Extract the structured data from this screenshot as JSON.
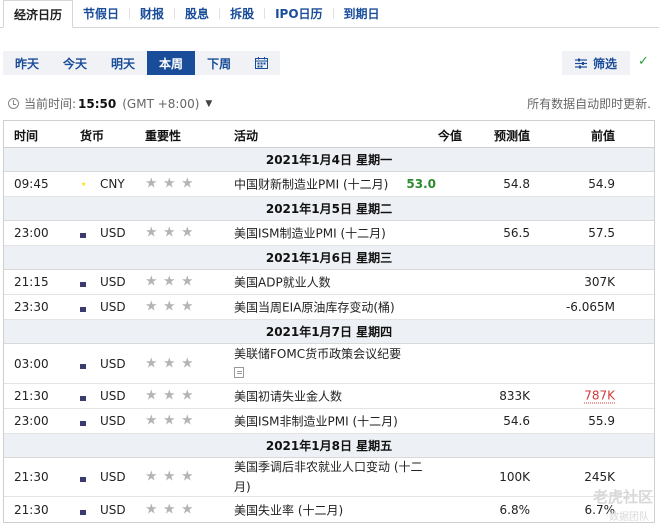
{
  "nav": {
    "tabs": [
      {
        "label": "经济日历",
        "active": true
      },
      {
        "label": "节假日"
      },
      {
        "label": "财报"
      },
      {
        "label": "股息"
      },
      {
        "label": "拆股"
      },
      {
        "label": "IPO日历"
      },
      {
        "label": "到期日"
      }
    ]
  },
  "period": {
    "buttons": [
      "昨天",
      "今天",
      "明天",
      "本周",
      "下周"
    ],
    "active": "本周",
    "calendar_icon": "calendar-icon"
  },
  "filter": {
    "label": "筛选",
    "icon": "sliders-icon"
  },
  "time": {
    "prefix": "当前时间:",
    "value": "15:50",
    "tz": "(GMT +8:00)",
    "chevron": "⌄"
  },
  "auto_update": "所有数据自动即时更新.",
  "table": {
    "headers": {
      "time": "时间",
      "currency": "货币",
      "importance": "重要性",
      "event": "活动",
      "actual": "今值",
      "forecast": "预测值",
      "previous": "前值"
    },
    "days": [
      {
        "date": "2021年1月4日  星期一",
        "rows": [
          {
            "time": "09:45",
            "flag": "cn",
            "currency": "CNY",
            "event": "中国财新制造业PMI (十二月)",
            "actual": "53.0",
            "forecast": "54.8",
            "previous": "54.9"
          }
        ]
      },
      {
        "date": "2021年1月5日  星期二",
        "rows": [
          {
            "time": "23:00",
            "flag": "us",
            "currency": "USD",
            "event": "美国ISM制造业PMI (十二月)",
            "actual": "",
            "forecast": "56.5",
            "previous": "57.5"
          }
        ]
      },
      {
        "date": "2021年1月6日  星期三",
        "rows": [
          {
            "time": "21:15",
            "flag": "us",
            "currency": "USD",
            "event": "美国ADP就业人数",
            "actual": "",
            "forecast": "",
            "previous": "307K"
          },
          {
            "time": "23:30",
            "flag": "us",
            "currency": "USD",
            "event": "美国当周EIA原油库存变动(桶)",
            "actual": "",
            "forecast": "",
            "previous": "-6.065M"
          }
        ]
      },
      {
        "date": "2021年1月7日  星期四",
        "rows": [
          {
            "time": "03:00",
            "flag": "us",
            "currency": "USD",
            "event": "美联储FOMC货币政策会议纪要",
            "actual": "",
            "forecast": "",
            "previous": ""
          },
          {
            "time": "21:30",
            "flag": "us",
            "currency": "USD",
            "event": "美国初请失业金人数",
            "actual": "",
            "forecast": "833K",
            "previous": "787K"
          },
          {
            "time": "23:00",
            "flag": "us",
            "currency": "USD",
            "event": "美国ISM非制造业PMI (十二月)",
            "actual": "",
            "forecast": "54.6",
            "previous": "55.9"
          }
        ]
      },
      {
        "date": "2021年1月8日  星期五",
        "rows": [
          {
            "time": "21:30",
            "flag": "us",
            "currency": "USD",
            "event": "美国季调后非农就业人口变动 (十二月)",
            "actual": "",
            "forecast": "100K",
            "previous": "245K"
          },
          {
            "time": "21:30",
            "flag": "us",
            "currency": "USD",
            "event": "美国失业率 (十二月)",
            "actual": "",
            "forecast": "6.8%",
            "previous": "6.7%"
          }
        ]
      }
    ]
  },
  "colors": {
    "accent": "#1a4d99",
    "positive": "#2d8a2d",
    "negative": "#d23b3b"
  },
  "watermark": {
    "line1": "老虎社区",
    "line2": "数据团队"
  }
}
